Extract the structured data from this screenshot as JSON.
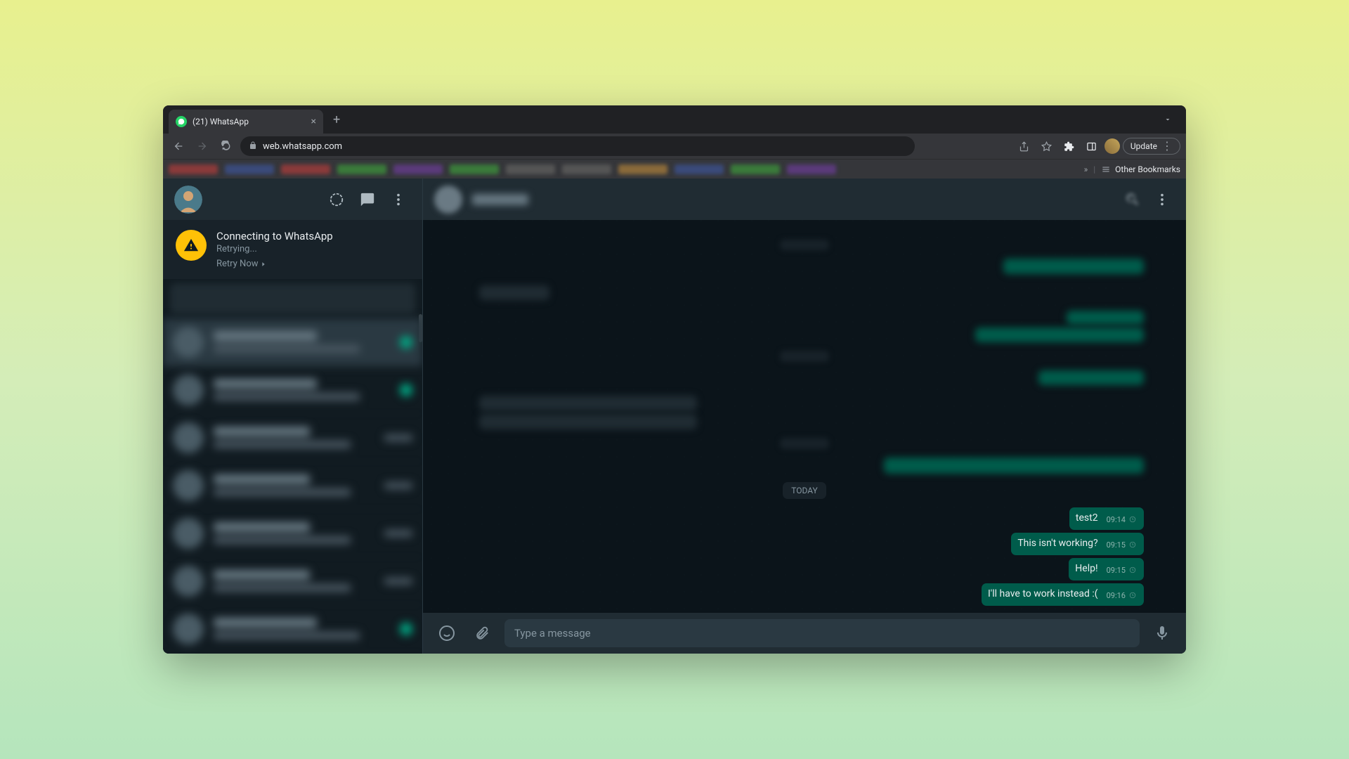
{
  "browser": {
    "tab_title": "(21) WhatsApp",
    "url": "web.whatsapp.com",
    "update_label": "Update",
    "other_bookmarks_label": "Other Bookmarks",
    "overflow": "»"
  },
  "connection": {
    "title": "Connecting to WhatsApp",
    "subtitle": "Retrying...",
    "retry": "Retry Now"
  },
  "conversation": {
    "day_label": "TODAY",
    "messages": [
      {
        "text": "test2",
        "time": "09:14"
      },
      {
        "text": "This isn't working?",
        "time": "09:15"
      },
      {
        "text": "Help!",
        "time": "09:15"
      },
      {
        "text": "I'll have to work instead :(",
        "time": "09:16"
      }
    ],
    "composer_placeholder": "Type a message"
  }
}
